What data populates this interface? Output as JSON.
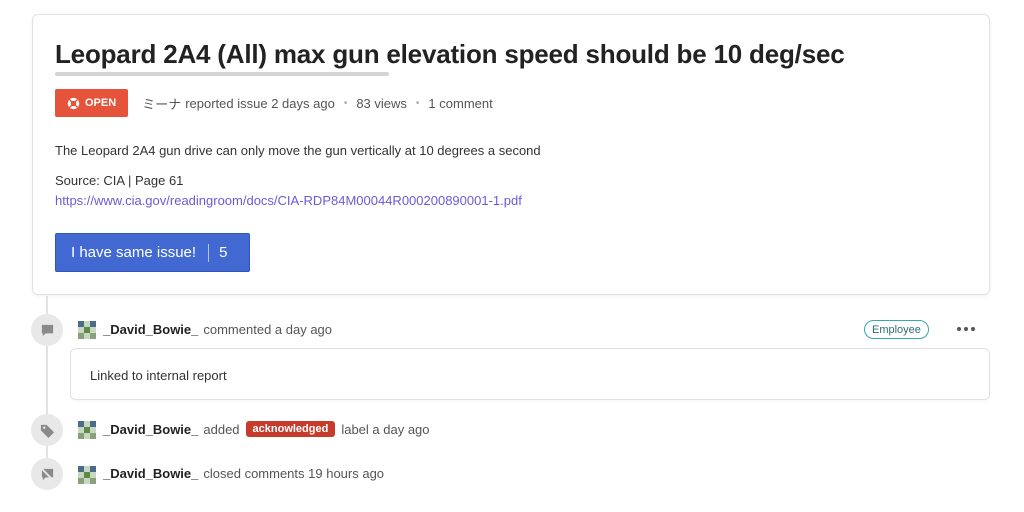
{
  "issue": {
    "title": "Leopard 2A4 (All) max gun elevation speed should be 10 deg/sec",
    "status": "OPEN",
    "author": "ミーナ",
    "reported_text": "reported issue 2 days ago",
    "views": "83 views",
    "comments": "1 comment",
    "body": "The Leopard 2A4 gun drive can only move the gun vertically at 10 degrees a second",
    "source": "Source: CIA | Page 61",
    "link": "https://www.cia.gov/readingroom/docs/CIA-RDP84M00044R000200890001-1.pdf",
    "same_issue_label": "I have same issue!",
    "same_issue_count": "5"
  },
  "timeline": [
    {
      "icon": "comment-icon",
      "user": "_David_Bowie_",
      "action": "commented a day ago",
      "badge": "Employee",
      "comment": "Linked to internal report"
    },
    {
      "icon": "tag-icon",
      "user": "_David_Bowie_",
      "action_before": "added",
      "label": "acknowledged",
      "action_after": "label a day ago"
    },
    {
      "icon": "comments-off-icon",
      "user": "_David_Bowie_",
      "action": "closed comments 19 hours ago"
    }
  ],
  "colors": {
    "open": "#e4533a",
    "acknowledged": "#c63b2b",
    "button": "#4169d1",
    "link": "#6b5ad6",
    "employee_border": "#37a7b0"
  }
}
